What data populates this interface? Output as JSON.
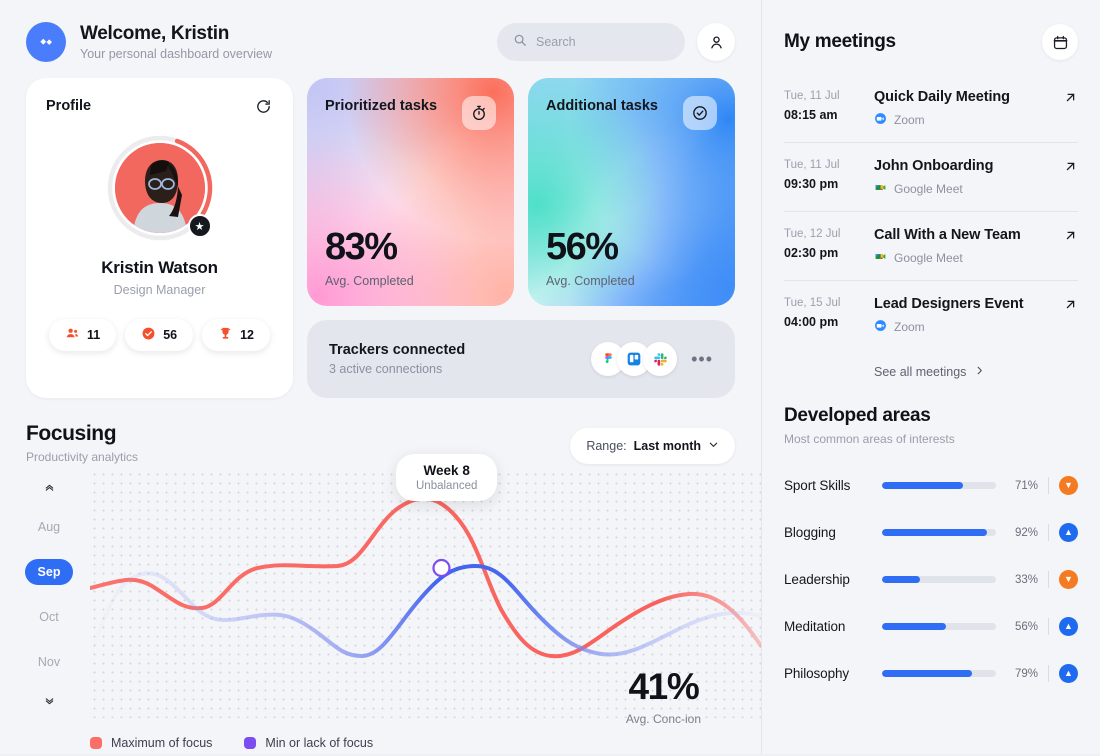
{
  "header": {
    "logo_icon": "diamond-logo",
    "title": "Welcome, Kristin",
    "subtitle": "Your personal dashboard overview",
    "search": {
      "placeholder": "Search",
      "icon": "search-icon"
    },
    "avatar_icon": "user-icon"
  },
  "profile": {
    "card_title": "Profile",
    "refresh_icon": "refresh-icon",
    "badge_icon": "star-icon",
    "name": "Kristin Watson",
    "role": "Design Manager",
    "ring_progress": 28,
    "stats": [
      {
        "icon": "people-icon",
        "value": "11"
      },
      {
        "icon": "check-circle-icon",
        "value": "56"
      },
      {
        "icon": "trophy-icon",
        "value": "12"
      }
    ]
  },
  "task_cards": [
    {
      "label": "Prioritized tasks",
      "icon": "stopwatch-icon",
      "percent": "83%",
      "caption": "Avg. Completed"
    },
    {
      "label": "Additional tasks",
      "icon": "check-circle-outline-icon",
      "percent": "56%",
      "caption": "Avg. Completed"
    }
  ],
  "trackers": {
    "title": "Trackers connected",
    "subtitle": "3 active connections",
    "apps": [
      "figma-icon",
      "trello-icon",
      "slack-icon"
    ],
    "more_icon": "ellipsis-icon"
  },
  "focusing": {
    "title": "Focusing",
    "subtitle": "Productivity analytics",
    "range_label": "Range:",
    "range_value": "Last month",
    "range_chevron": "chevron-down-icon",
    "months": [
      "Aug",
      "Sep",
      "Oct",
      "Nov"
    ],
    "active_month": "Sep",
    "chevron_up": "chevron-up-icon",
    "chevron_down": "chevron-down-icon",
    "tooltip": {
      "title": "Week 8",
      "subtitle": "Unbalanced"
    },
    "big_stat": {
      "value": "41%",
      "caption": "Avg. Conc-ion"
    },
    "legend": [
      {
        "label": "Maximum of focus",
        "color": "#fa6e68"
      },
      {
        "label": "Min or lack of focus",
        "color": "#7c4df0"
      }
    ]
  },
  "chart_data": {
    "type": "line",
    "title": "Focusing",
    "subtitle": "Productivity analytics",
    "xlabel": "",
    "ylabel": "",
    "grid": "dotted",
    "legend_position": "bottom-left",
    "x": [
      0,
      1,
      2,
      3,
      4,
      5,
      6,
      7,
      8,
      9,
      10,
      11,
      12
    ],
    "series": [
      {
        "name": "Maximum of focus",
        "color": "#fa6e68",
        "values": [
          52,
          50,
          42,
          55,
          62,
          62,
          80,
          84,
          60,
          36,
          34,
          58,
          66
        ]
      },
      {
        "name": "Min or lack of focus",
        "color": "#6f7ef0",
        "values": [
          66,
          68,
          62,
          50,
          48,
          40,
          34,
          52,
          70,
          68,
          54,
          48,
          50
        ]
      }
    ],
    "annotations": [
      {
        "label": "Week 8",
        "sublabel": "Unbalanced",
        "series": "Min or lack of focus",
        "x": 7
      }
    ],
    "summary": {
      "value": 41,
      "unit": "%",
      "caption": "Avg. Conc-ion"
    }
  },
  "meetings": {
    "title": "My meetings",
    "calendar_icon": "calendar-icon",
    "see_all": "See all meetings",
    "see_all_icon": "chevron-right-icon",
    "items": [
      {
        "date": "Tue, 11 Jul",
        "time": "08:15 am",
        "name": "Quick Daily Meeting",
        "platform": "Zoom",
        "platform_icon": "zoom-icon",
        "link_icon": "arrow-up-right-icon"
      },
      {
        "date": "Tue, 11 Jul",
        "time": "09:30 pm",
        "name": "John Onboarding",
        "platform": "Google Meet",
        "platform_icon": "google-meet-icon",
        "link_icon": "arrow-up-right-icon"
      },
      {
        "date": "Tue, 12 Jul",
        "time": "02:30 pm",
        "name": "Call With a New Team",
        "platform": "Google Meet",
        "platform_icon": "google-meet-icon",
        "link_icon": "arrow-up-right-icon"
      },
      {
        "date": "Tue, 15 Jul",
        "time": "04:00 pm",
        "name": "Lead Designers Event",
        "platform": "Zoom",
        "platform_icon": "zoom-icon",
        "link_icon": "arrow-up-right-icon"
      }
    ]
  },
  "developed": {
    "title": "Developed areas",
    "subtitle": "Most common areas of interests",
    "items": [
      {
        "name": "Sport Skills",
        "percent": "71%",
        "value": 71,
        "trend": "down"
      },
      {
        "name": "Blogging",
        "percent": "92%",
        "value": 92,
        "trend": "up"
      },
      {
        "name": "Leadership",
        "percent": "33%",
        "value": 33,
        "trend": "down"
      },
      {
        "name": "Meditation",
        "percent": "56%",
        "value": 56,
        "trend": "up"
      },
      {
        "name": "Philosophy",
        "percent": "79%",
        "value": 79,
        "trend": "up"
      }
    ]
  },
  "colors": {
    "accent": "#2f6df5",
    "up": "#1f6bf0",
    "down": "#f57b22",
    "red": "#fa6e68",
    "purple": "#7c4df0"
  }
}
